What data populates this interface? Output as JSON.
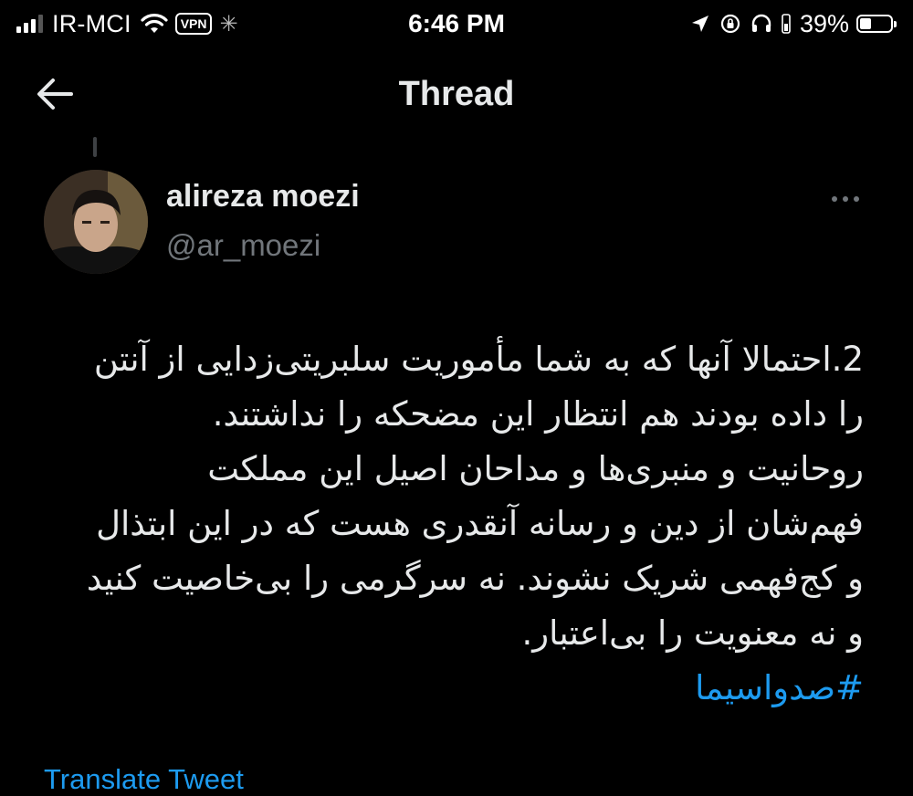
{
  "status_bar": {
    "carrier": "IR-MCI",
    "vpn": "VPN",
    "time": "6:46 PM",
    "battery_percent": "39%",
    "battery_level": 0.39,
    "signal_bars": 3,
    "signal_bars_total": 4,
    "icons": [
      "signal-icon",
      "wifi-icon",
      "vpn-badge",
      "activity-spinner-icon",
      "location-arrow-icon",
      "orientation-lock-icon",
      "headphones-icon",
      "battery-icon"
    ]
  },
  "header": {
    "title": "Thread",
    "back_icon": "arrow-left-icon"
  },
  "tweet": {
    "author_name": "alireza moezi",
    "author_handle": "@ar_moezi",
    "more_icon": "more-dots-icon",
    "text_lines": [
      "2.احتمالا آنها که به شما مأموریت سلبریتی‌زدایی از آنتن",
      "را داده بودند هم انتظار این مضحکه را نداشتند.",
      "روحانیت و منبری‌ها و مداحان اصیل این مملکت",
      "فهم‌شان از دین و رسانه آنقدری هست که در این ابتذال",
      "و کج‌فهمی شریک نشوند. نه سرگرمی را بی‌خاصیت کنید",
      "و نه معنویت را بی‌اعتبار."
    ],
    "hashtag": "#صدواسیما",
    "translate_label": "Translate Tweet"
  },
  "colors": {
    "background": "#000000",
    "text": "#e7e9ea",
    "secondary": "#71767b",
    "link": "#1d9bf0"
  }
}
